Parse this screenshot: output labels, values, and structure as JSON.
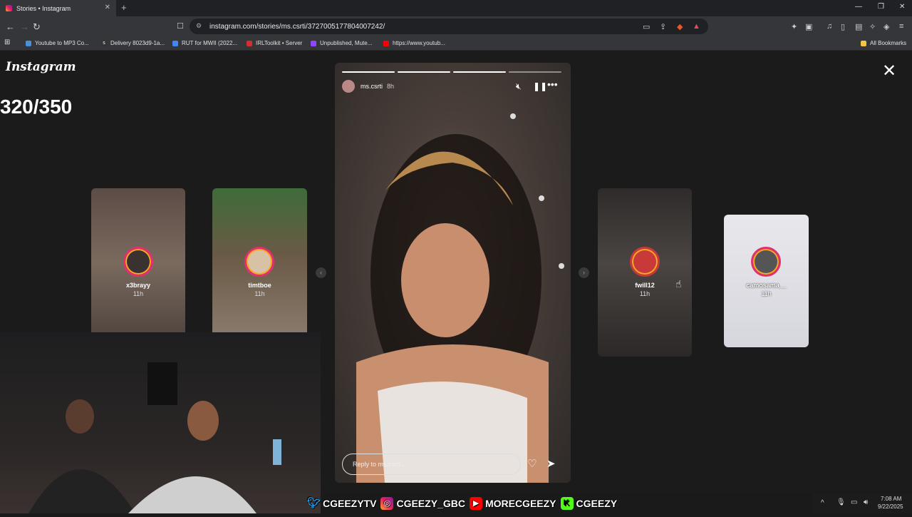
{
  "browser": {
    "tab_title": "Stories • Instagram",
    "url": "instagram.com/stories/ms.csrti/3727005177804007242/",
    "bookmarks": [
      "Youtube to MP3 Co...",
      "Delivery 8023d9-1a...",
      "RUT for MWII (2022...",
      "IRLToolkit • Server",
      "Unpublished, Mute...",
      "https://www.youtub..."
    ],
    "all_bookmarks": "All Bookmarks"
  },
  "page": {
    "logo": "Instagram",
    "counter": "320/350"
  },
  "main_story": {
    "username": "ms.csrti",
    "time": "8h",
    "reply_placeholder": "Reply to ms.csrti..."
  },
  "side_stories": [
    {
      "name": "x3brayy",
      "time": "11h"
    },
    {
      "name": "timtboe",
      "time": "11h"
    },
    {
      "name": "fwill12",
      "time": "11h"
    },
    {
      "name": "camosama__",
      "time": "11h"
    }
  ],
  "overlay": {
    "twitter": "CGEEZYTV",
    "instagram": "CGEEZY_GBC",
    "youtube": "MORECGEEZY",
    "kick": "CGEEZY"
  },
  "system": {
    "time": "7:08 AM",
    "date": "9/22/2025"
  }
}
